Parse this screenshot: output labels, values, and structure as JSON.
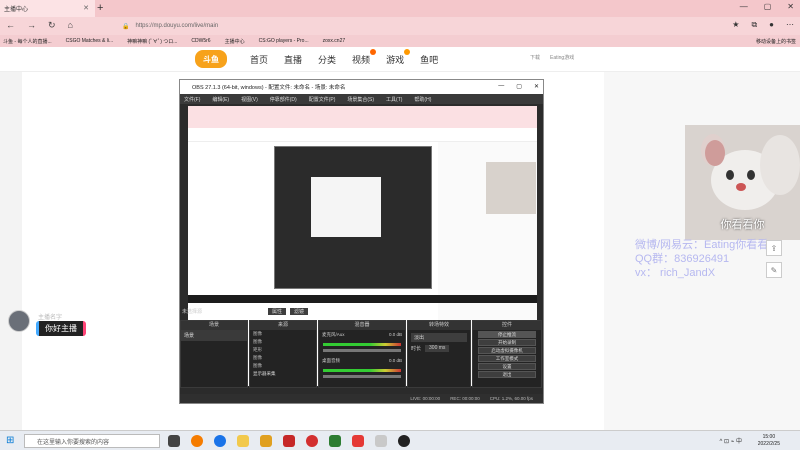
{
  "browser": {
    "tab_title": "主播中心",
    "new_tab": "+",
    "url": "https://mp.douyu.com/live/main",
    "bookmarks": [
      "斗鱼 - 每个人的直播...",
      "CSGO Matches & li...",
      "神嘛神嘛 (ﾟ∀ﾟ) つロ...",
      "CDW5r6",
      "主播中心",
      "CS:GO players - Pro...",
      "zoxx.cn27"
    ],
    "bookmark_right": "移动设备上的书签",
    "window_controls": [
      "—",
      "▢",
      "✕"
    ]
  },
  "site": {
    "logo": "斗鱼",
    "nav": [
      "首页",
      "直播",
      "分类",
      "视频",
      "游戏",
      "鱼吧"
    ],
    "user_items": [
      "下载",
      "Eating游戏"
    ]
  },
  "overlay": {
    "cam_caption": "你看看你",
    "lines": [
      "微博/网易云：Eating你看看",
      "QQ群：836926491",
      "vx：  rich_JandX"
    ],
    "avatar_name": "主播名字",
    "hello": "你好主播"
  },
  "obs": {
    "title": "OBS 27.1.3 (64-bit, windows) - 配置文件: 未命名 - 场景: 未命名",
    "menu": [
      "文件(F)",
      "编辑(E)",
      "视图(V)",
      "停靠部件(D)",
      "配置文件(P)",
      "场景集合(S)",
      "工具(T)",
      "帮助(H)"
    ],
    "no_source": "未选择源",
    "prop_buttons": [
      "属性",
      "滤镜"
    ],
    "docks": {
      "scenes": "场景",
      "sources": "来源",
      "mixer": "混音器",
      "transitions": "转场特效",
      "controls": "控件"
    },
    "scene_items": [
      "场景"
    ],
    "source_items": [
      "图像",
      "图像",
      "矩形",
      "图像",
      "图像",
      "显示器采集"
    ],
    "mixer_tracks": [
      {
        "name": "麦克风/Aux",
        "db": "0.0 dB"
      },
      {
        "name": "桌面音频",
        "db": "0.0 dB"
      }
    ],
    "transition": {
      "type": "淡出",
      "duration_label": "时长",
      "duration": "300 ms"
    },
    "control_buttons": [
      "停止推流",
      "开始录制",
      "启动虚拟摄像机",
      "工作室模式",
      "设置",
      "退出"
    ],
    "status": [
      "LIVE: 00:00:00",
      "REC: 00:00:00",
      "CPU: 1.2%, 60.00 fps"
    ]
  },
  "taskbar": {
    "search_placeholder": "在这里输入你要搜索的内容",
    "time": "15:00",
    "date": "2022/2/25",
    "tray": "^ ⊡ ⌁ 中"
  }
}
